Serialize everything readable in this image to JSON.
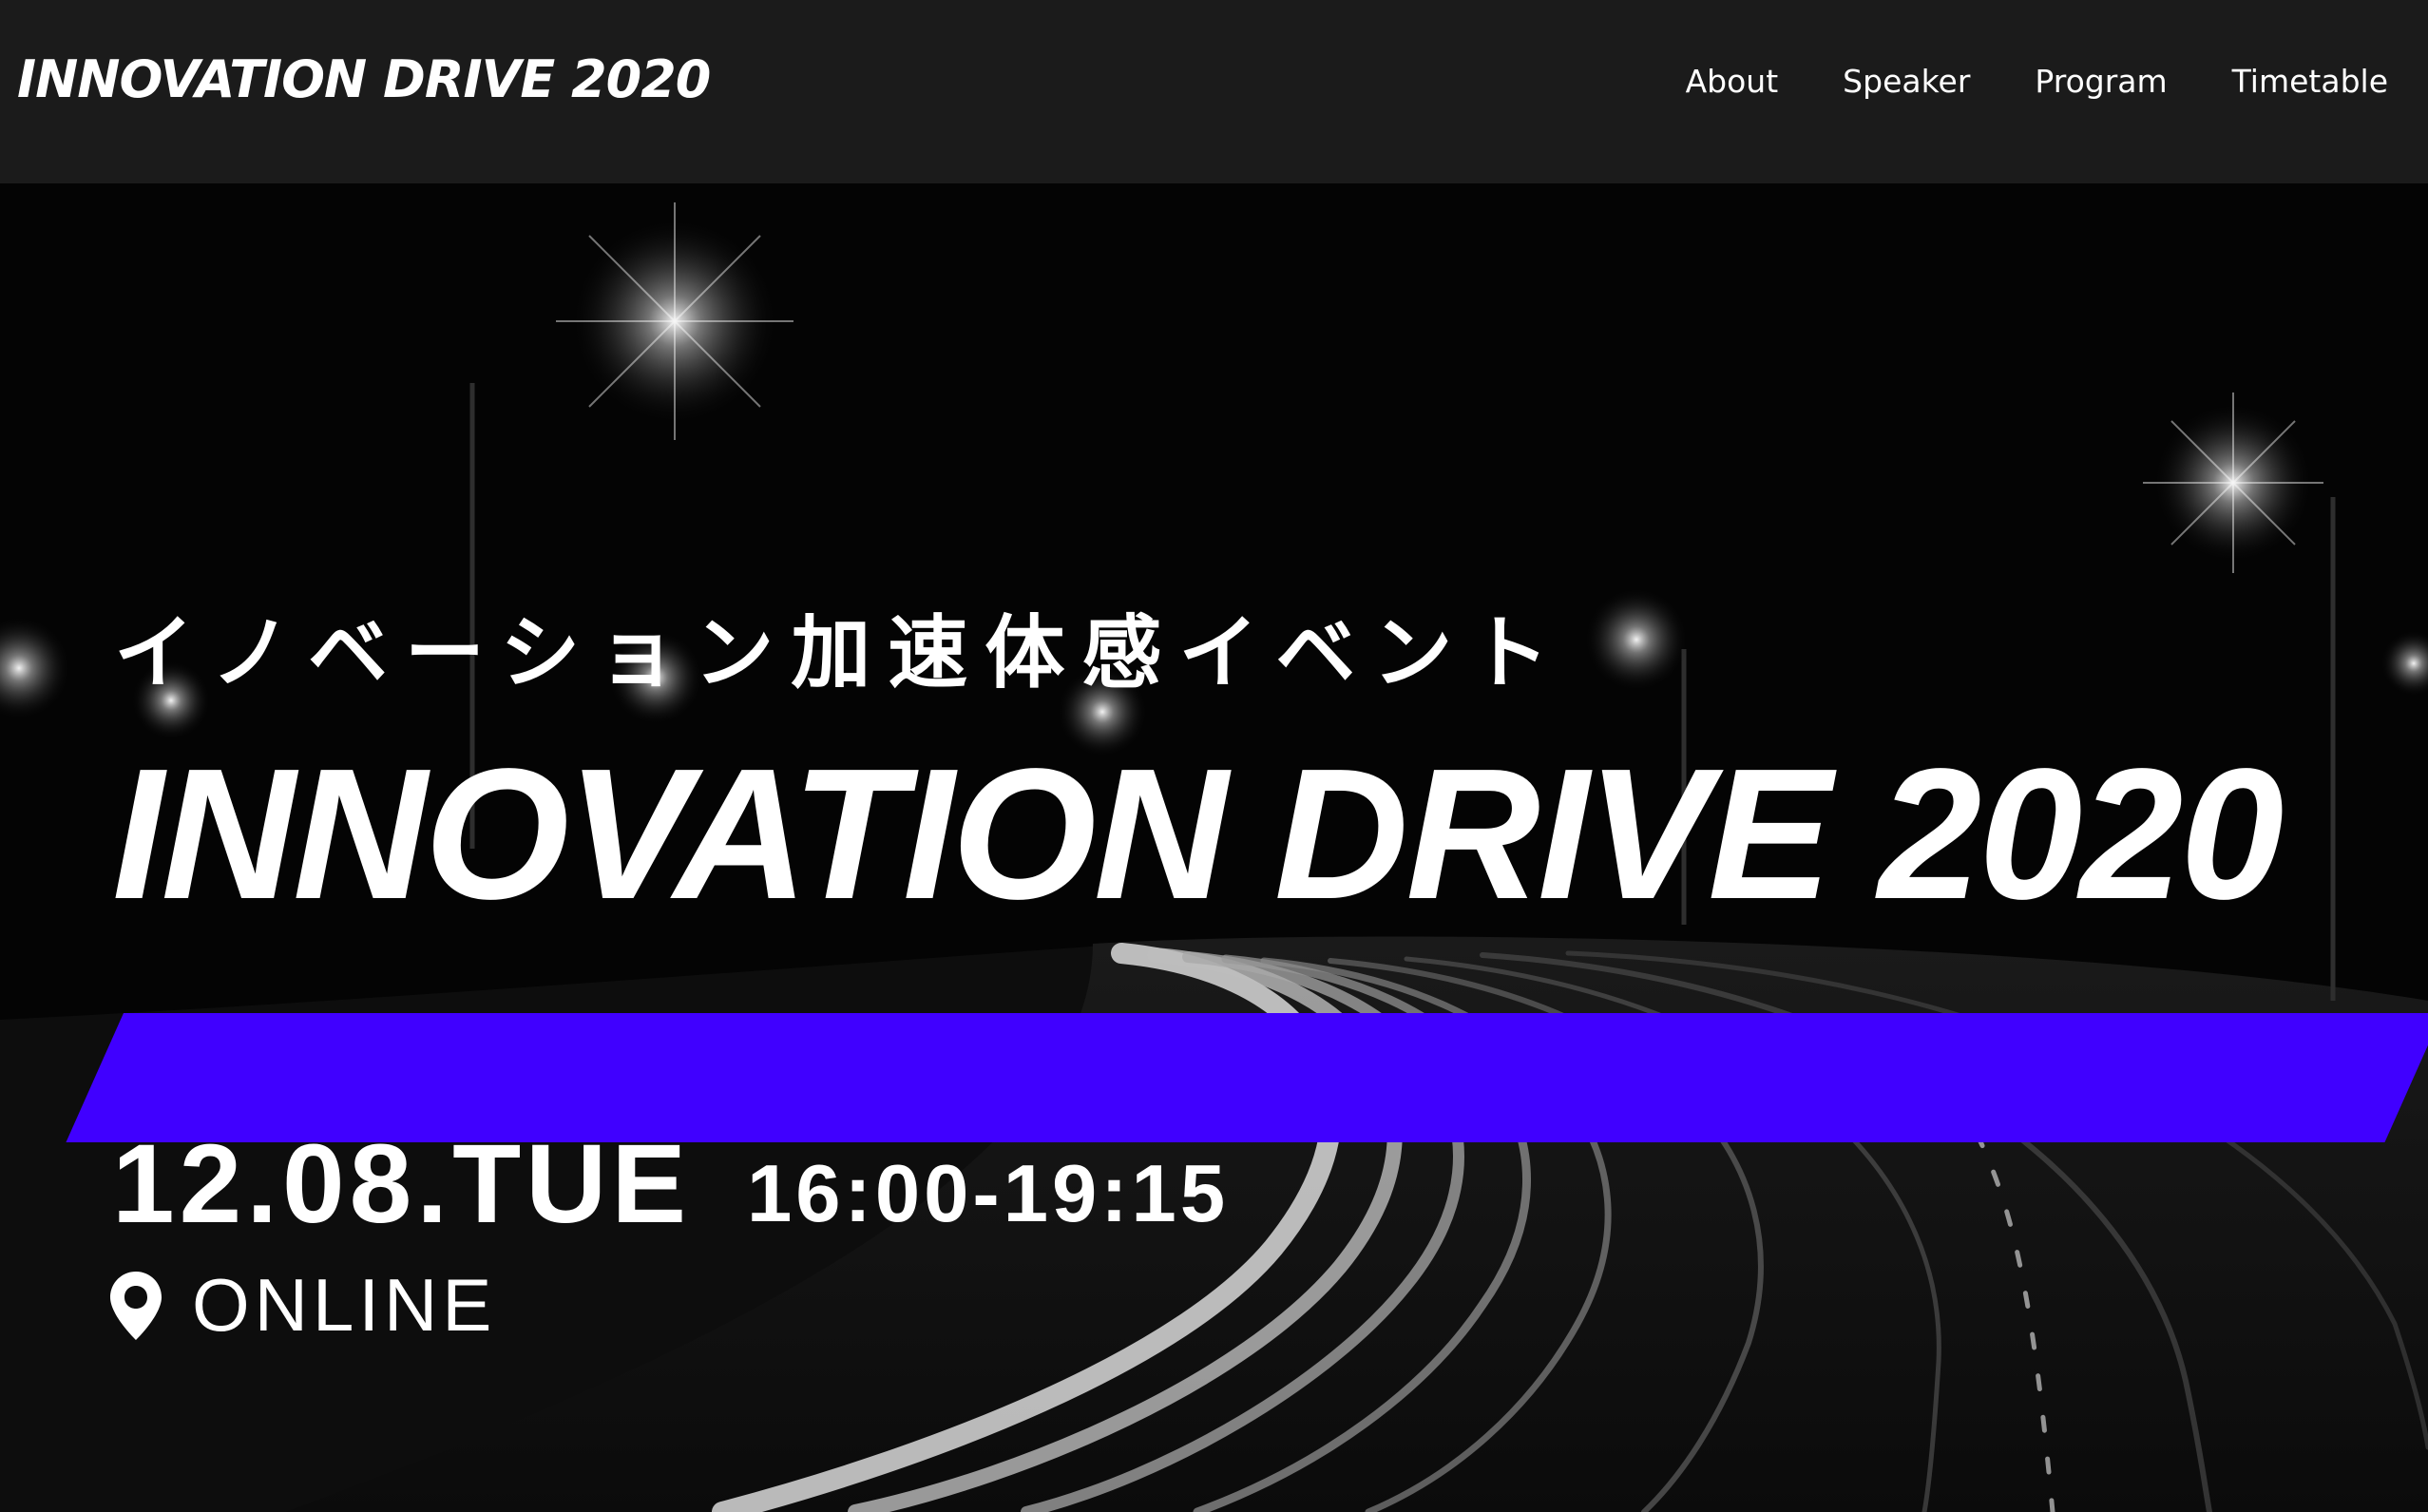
{
  "header": {
    "brand": "INNOVATION DRIVE 2020",
    "nav": [
      "About",
      "Speaker",
      "Program",
      "Timetable"
    ]
  },
  "hero": {
    "subtitle": "イノベーション加速体感イベント",
    "title": "INNOVATION DRIVE 2020",
    "date": "12.08.TUE",
    "time": "16:00-19:15",
    "location": "ONLINE",
    "accent_color": "#4000ff"
  },
  "icons": {
    "location": "map-pin-icon"
  }
}
